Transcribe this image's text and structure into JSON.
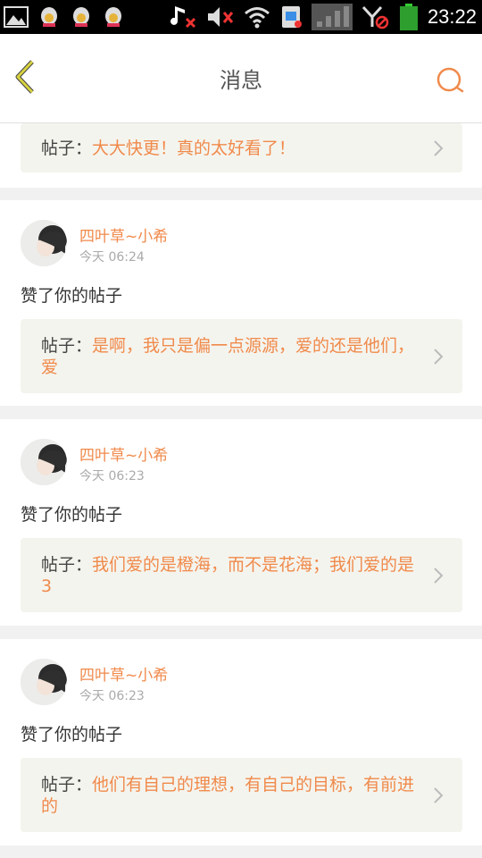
{
  "status_bar": {
    "time": "23:22",
    "icons": [
      "gallery-icon",
      "qq-icon",
      "qq-icon",
      "qq-icon",
      "music-muted-icon",
      "volume-muted-icon",
      "wifi-icon",
      "sim-icon",
      "signal-icon",
      "no-signal-icon",
      "battery-icon"
    ]
  },
  "header": {
    "title": "消息"
  },
  "colors": {
    "accent": "#f08a4b",
    "back_arrow": "#c8c832",
    "post_bg": "#f4f4ee"
  },
  "feed": {
    "top_partial": {
      "prefix": "帖子：",
      "text": "大大快更！真的太好看了！"
    },
    "items": [
      {
        "username": "四叶草~小希",
        "time": "今天 06:24",
        "action": "赞了你的帖子",
        "post_prefix": "帖子：",
        "post_text": "是啊，我只是偏一点源源，爱的还是他们，爱"
      },
      {
        "username": "四叶草~小希",
        "time": "今天 06:23",
        "action": "赞了你的帖子",
        "post_prefix": "帖子：",
        "post_text": "我们爱的是橙海，而不是花海；我们爱的是3"
      },
      {
        "username": "四叶草~小希",
        "time": "今天 06:23",
        "action": "赞了你的帖子",
        "post_prefix": "帖子：",
        "post_text": "他们有自己的理想，有自己的目标，有前进的"
      }
    ]
  }
}
